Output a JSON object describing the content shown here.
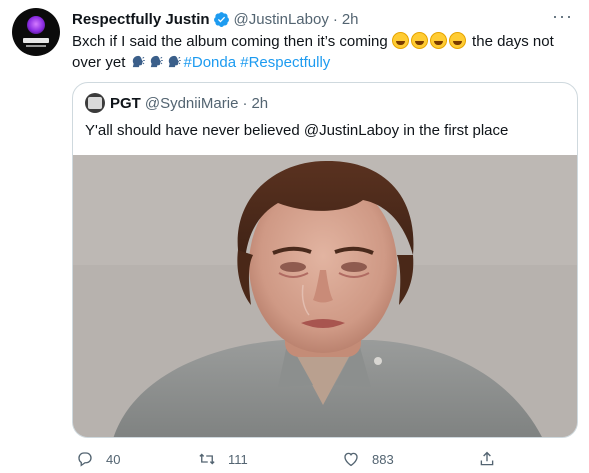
{
  "tweet": {
    "display_name": "Respectfully Justin",
    "handle": "@JustinLaboy",
    "separator": "·",
    "time": "2h",
    "more_label": "···",
    "text_part1": "Bxch if I said the album coming then it’s coming ",
    "text_part2": " the days not over yet ",
    "hashtag1": "#Donda",
    "hashtag2": "#Respectfully",
    "emojis": [
      "rolling-on-floor-laughing",
      "rolling-on-floor-laughing",
      "rolling-on-floor-laughing",
      "rolling-on-floor-laughing",
      "speaking-head",
      "speaking-head",
      "speaking-head"
    ]
  },
  "quote": {
    "display_name": "PGT",
    "handle": "@SydniiMarie",
    "separator": "·",
    "time": "2h",
    "text": "Y'all should have never believed @JustinLaboy in the first place",
    "image_subject": "crying woman with short brown hair in grey shirt"
  },
  "actions": {
    "reply_count": "40",
    "retweet_count": "111",
    "like_count": "883"
  },
  "colors": {
    "link": "#1d9bf0",
    "secondary_text": "#536471",
    "border": "#cfd9de",
    "primary_text": "#0f1419"
  }
}
